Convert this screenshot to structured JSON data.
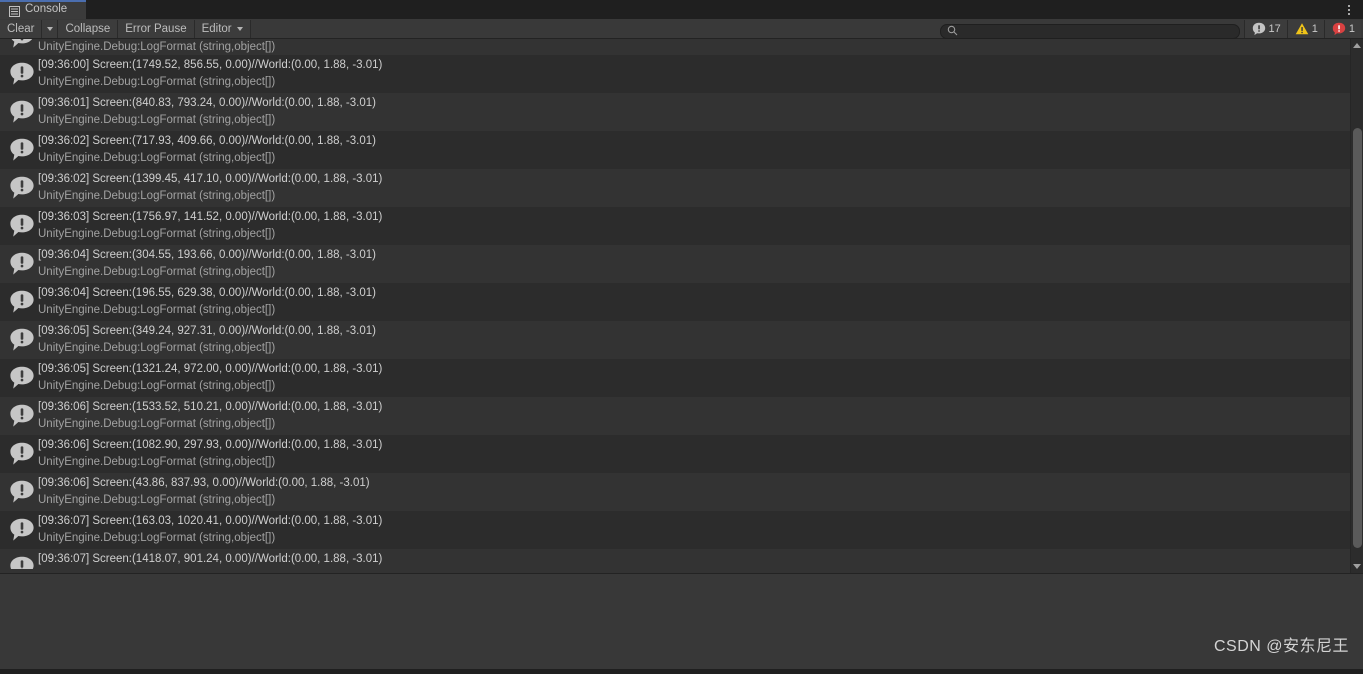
{
  "window": {
    "title": "Console",
    "tab_icon": "list-lines-icon",
    "menu_icon": "kebab-menu-icon",
    "accent_color": "#4b6eaf",
    "background_color": "#383838"
  },
  "toolbar": {
    "clear_label": "Clear",
    "clear_dropdown_icon": "chevron-down-icon",
    "collapse_label": "Collapse",
    "error_pause_label": "Error Pause",
    "editor_label": "Editor",
    "editor_dropdown_icon": "chevron-down-icon",
    "search": {
      "value": "",
      "placeholder": "",
      "icon": "search-icon"
    },
    "counters": [
      {
        "name": "info",
        "icon": "info-bubble-icon",
        "count": "17",
        "color": "#c4c4c4"
      },
      {
        "name": "warning",
        "icon": "warning-triangle-icon",
        "count": "1",
        "color": "#f0c419"
      },
      {
        "name": "error",
        "icon": "error-circle-icon",
        "count": "1",
        "color": "#d94141"
      }
    ]
  },
  "log": {
    "trace_line": "UnityEngine.Debug:LogFormat (string,object[])",
    "entries": [
      {
        "icon": "info-bubble-icon",
        "message": "",
        "trace": "UnityEngine.Debug:LogFormat (string,object[])",
        "clip": "top"
      },
      {
        "icon": "info-bubble-icon",
        "message": "[09:36:00] Screen:(1749.52, 856.55, 0.00)//World:(0.00, 1.88, -3.01)",
        "trace": "UnityEngine.Debug:LogFormat (string,object[])"
      },
      {
        "icon": "info-bubble-icon",
        "message": "[09:36:01] Screen:(840.83, 793.24, 0.00)//World:(0.00, 1.88, -3.01)",
        "trace": "UnityEngine.Debug:LogFormat (string,object[])"
      },
      {
        "icon": "info-bubble-icon",
        "message": "[09:36:02] Screen:(717.93, 409.66, 0.00)//World:(0.00, 1.88, -3.01)",
        "trace": "UnityEngine.Debug:LogFormat (string,object[])"
      },
      {
        "icon": "info-bubble-icon",
        "message": "[09:36:02] Screen:(1399.45, 417.10, 0.00)//World:(0.00, 1.88, -3.01)",
        "trace": "UnityEngine.Debug:LogFormat (string,object[])"
      },
      {
        "icon": "info-bubble-icon",
        "message": "[09:36:03] Screen:(1756.97, 141.52, 0.00)//World:(0.00, 1.88, -3.01)",
        "trace": "UnityEngine.Debug:LogFormat (string,object[])"
      },
      {
        "icon": "info-bubble-icon",
        "message": "[09:36:04] Screen:(304.55, 193.66, 0.00)//World:(0.00, 1.88, -3.01)",
        "trace": "UnityEngine.Debug:LogFormat (string,object[])"
      },
      {
        "icon": "info-bubble-icon",
        "message": "[09:36:04] Screen:(196.55, 629.38, 0.00)//World:(0.00, 1.88, -3.01)",
        "trace": "UnityEngine.Debug:LogFormat (string,object[])"
      },
      {
        "icon": "info-bubble-icon",
        "message": "[09:36:05] Screen:(349.24, 927.31, 0.00)//World:(0.00, 1.88, -3.01)",
        "trace": "UnityEngine.Debug:LogFormat (string,object[])"
      },
      {
        "icon": "info-bubble-icon",
        "message": "[09:36:05] Screen:(1321.24, 972.00, 0.00)//World:(0.00, 1.88, -3.01)",
        "trace": "UnityEngine.Debug:LogFormat (string,object[])"
      },
      {
        "icon": "info-bubble-icon",
        "message": "[09:36:06] Screen:(1533.52, 510.21, 0.00)//World:(0.00, 1.88, -3.01)",
        "trace": "UnityEngine.Debug:LogFormat (string,object[])"
      },
      {
        "icon": "info-bubble-icon",
        "message": "[09:36:06] Screen:(1082.90, 297.93, 0.00)//World:(0.00, 1.88, -3.01)",
        "trace": "UnityEngine.Debug:LogFormat (string,object[])"
      },
      {
        "icon": "info-bubble-icon",
        "message": "[09:36:06] Screen:(43.86, 837.93, 0.00)//World:(0.00, 1.88, -3.01)",
        "trace": "UnityEngine.Debug:LogFormat (string,object[])"
      },
      {
        "icon": "info-bubble-icon",
        "message": "[09:36:07] Screen:(163.03, 1020.41, 0.00)//World:(0.00, 1.88, -3.01)",
        "trace": "UnityEngine.Debug:LogFormat (string,object[])"
      },
      {
        "icon": "info-bubble-icon",
        "message": "[09:36:07] Screen:(1418.07, 901.24, 0.00)//World:(0.00, 1.88, -3.01)",
        "trace": "",
        "clip": "bottom"
      }
    ]
  },
  "scrollbar": {
    "up_arrow_icon": "triangle-up-icon",
    "down_arrow_icon": "triangle-down-icon"
  },
  "detail": {
    "text": "",
    "watermark": "CSDN @安东尼王"
  }
}
